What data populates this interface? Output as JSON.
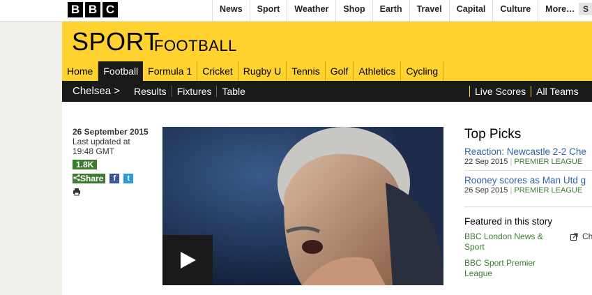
{
  "topbar": {
    "logo_letters": [
      "B",
      "B",
      "C"
    ],
    "nav": [
      "News",
      "Sport",
      "Weather",
      "Shop",
      "Earth",
      "Travel",
      "Capital",
      "Culture",
      "More…"
    ],
    "search_label": "S"
  },
  "sport": {
    "title": "SPORT",
    "subtitle": "FOOTBALL",
    "nav": [
      "Home",
      "Football",
      "Formula 1",
      "Cricket",
      "Rugby U",
      "Tennis",
      "Golf",
      "Athletics",
      "Cycling"
    ],
    "active": "Football"
  },
  "subnav": {
    "team": "Chelsea >",
    "links": [
      "Results",
      "Fixtures",
      "Table"
    ],
    "right_links": [
      "Live Scores",
      "All Teams"
    ]
  },
  "article": {
    "date": "26 September 2015",
    "updated_label": "Last updated at",
    "updated_time": "19:48 GMT",
    "share_count": "1.8K",
    "share_label": "Share",
    "facebook_icon": "facebook-icon",
    "twitter_icon": "twitter-icon",
    "print_icon": "print-icon",
    "play_icon": "play-icon"
  },
  "top_picks": {
    "title": "Top Picks",
    "items": [
      {
        "headline": "Reaction: Newcastle 2-2 Che",
        "date": "22 Sep 2015",
        "category": "PREMIER LEAGUE"
      },
      {
        "headline": "Rooney scores as Man Utd g",
        "date": "26 Sep 2015",
        "category": "PREMIER LEAGUE"
      }
    ]
  },
  "featured": {
    "title": "Featured in this story",
    "items": [
      "BBC London News & Sport",
      "BBC Sport Premier League"
    ],
    "right_item": "Ch"
  },
  "colors": {
    "sport_yellow": "#ffd230",
    "dark_nav": "#1a1a1a",
    "link_blue": "#2e63a5",
    "green": "#3d7a32"
  }
}
